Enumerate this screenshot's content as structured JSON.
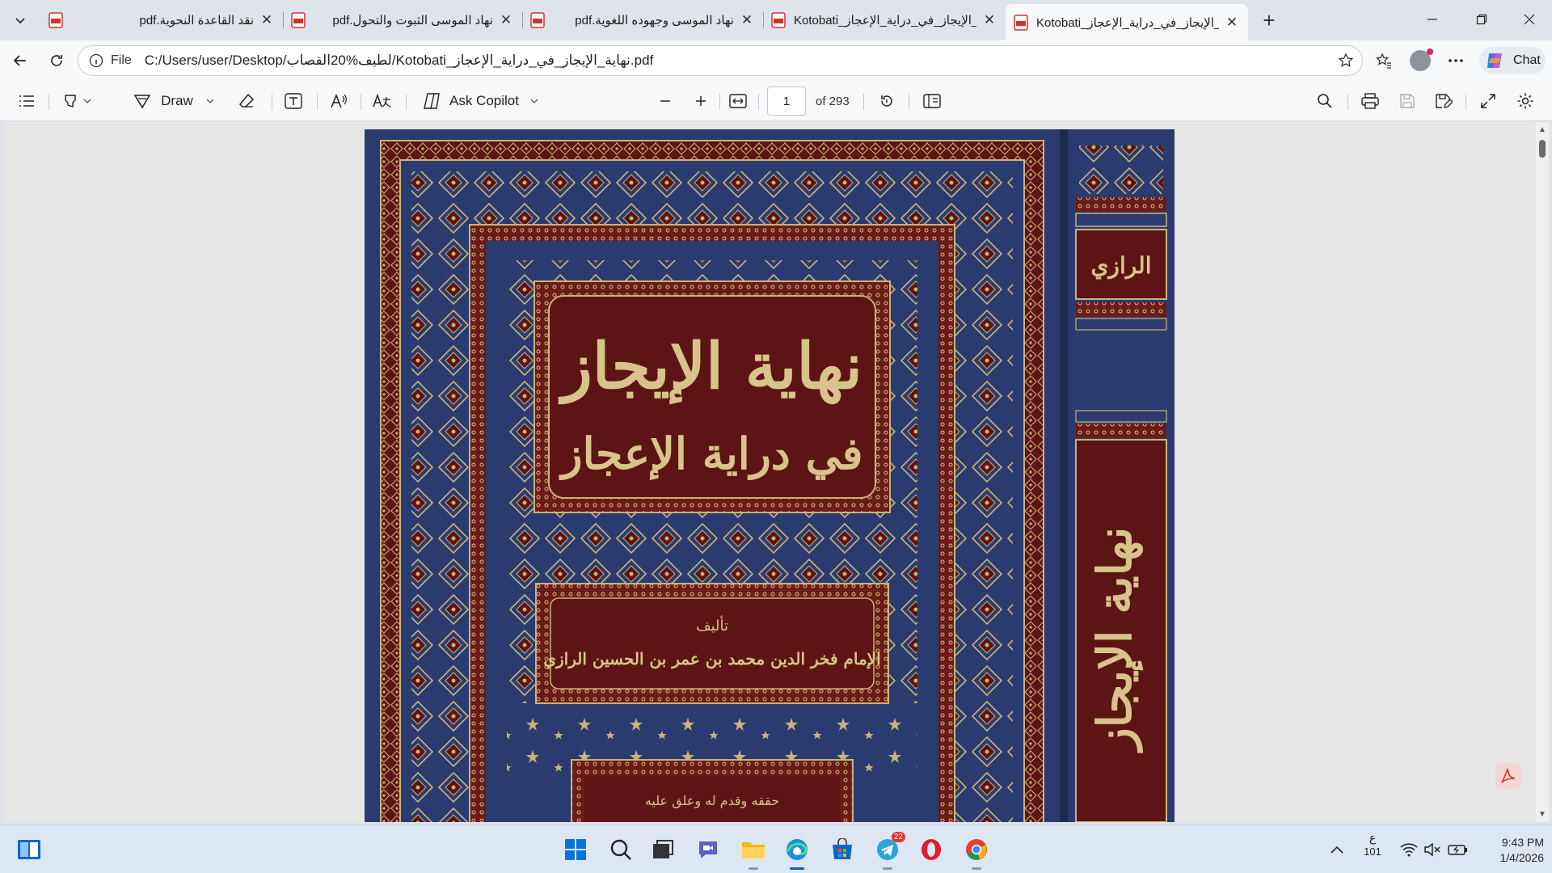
{
  "browser": {
    "tabs": [
      {
        "title": "نقد القاعدة النحوية.pdf",
        "active": false
      },
      {
        "title": "نهاد الموسى الثبوت والتحول.pdf",
        "active": false
      },
      {
        "title": "نهاد الموسى وجهوده اللغوية.pdf",
        "active": false
      },
      {
        "title": "Kotobati_نهاية_الإيجاز_في_دراية_الإعجاز",
        "active": false
      },
      {
        "title": "Kotobati_نهاية_الإيجاز_في_دراية_الإعجاز",
        "active": true
      }
    ],
    "close_glyph": "✕",
    "new_tab_glyph": "+",
    "address": {
      "scheme": "File",
      "url": "C:/Users/user/Desktop/لطيف%20القصاب/Kotobati_نهاية_الإيجاز_في_دراية_الإعجاز.pdf"
    },
    "chat_label": "Chat",
    "window_controls": [
      "minimize-icon",
      "restore-icon",
      "close-icon"
    ]
  },
  "pdf_toolbar": {
    "draw_label": "Draw",
    "copilot_label": "Ask Copilot",
    "page_number": "1",
    "page_count": "of 293",
    "icons": [
      "contents-icon",
      "highlight-icon",
      "draw-icon",
      "eraser-icon",
      "text-icon",
      "read-aloud-icon",
      "translate-icon",
      "copilot-icon",
      "zoom-out-icon",
      "zoom-in-icon",
      "fit-width-icon",
      "rotate-icon",
      "page-view-icon",
      "search-icon",
      "print-icon",
      "save-icon",
      "save-as-icon",
      "fullscreen-icon",
      "settings-icon"
    ]
  },
  "document": {
    "spine_author": "الرازي",
    "spine_title": "نهاية الإيجاز",
    "cover_title_line1": "نهاية الإيجاز",
    "cover_title_line2": "في دراية الإعجاز",
    "author_label": "تأليف",
    "author_name": "الإمام فخر الدين محمد بن عمر بن الحسين الرازي",
    "editor_line": "حققه وقدم له وعلق عليه",
    "colors": {
      "blue": "#2a3b6f",
      "maroon": "#5c1414",
      "gold": "#cbb37a"
    }
  },
  "taskbar": {
    "apps": [
      "start-icon",
      "search-icon",
      "task-view-icon",
      "meet-icon",
      "file-explorer-icon",
      "edge-icon",
      "store-icon",
      "telegram-icon",
      "opera-icon",
      "chrome-icon"
    ],
    "telegram_badge": "22",
    "input_lang": "ع",
    "input_code": "101",
    "time": "9:43 PM",
    "date": "1/4/2026"
  }
}
